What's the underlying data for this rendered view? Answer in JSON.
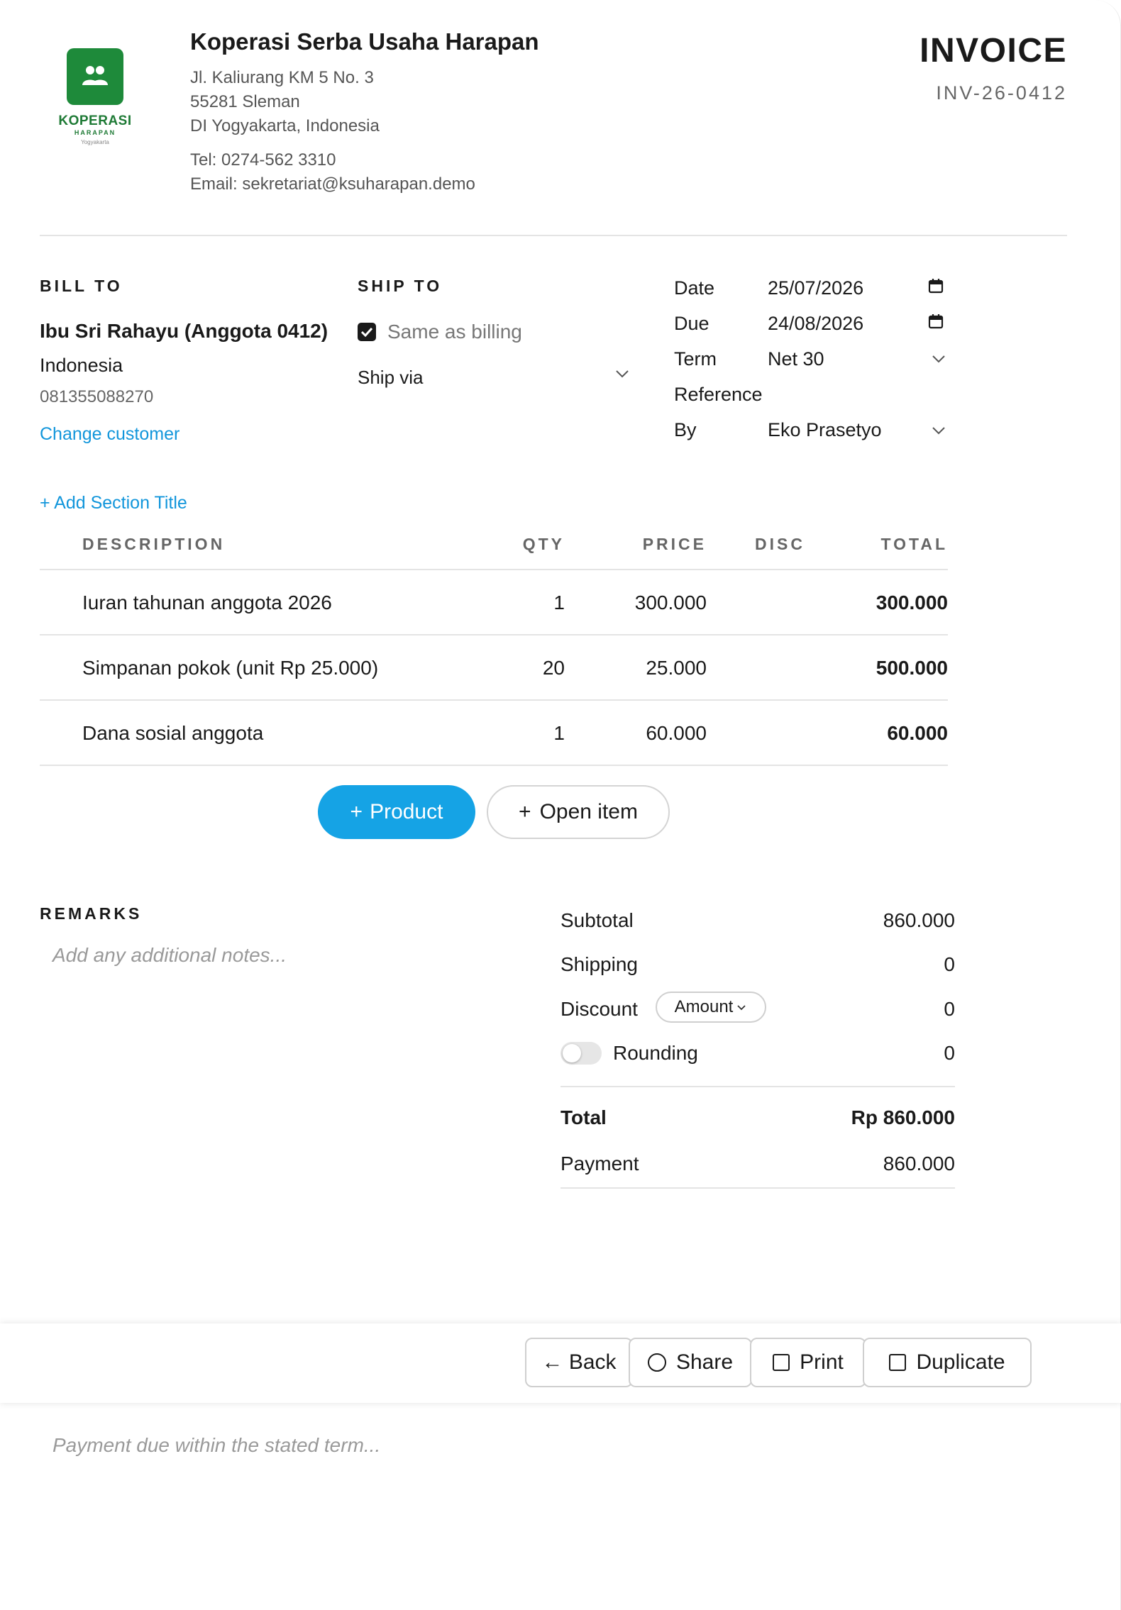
{
  "company": {
    "logo": {
      "name": "KOPERASI",
      "sub": "HARAPAN",
      "city": "Yogyakarta"
    },
    "name": "Koperasi Serba Usaha Harapan",
    "address_line1": "Jl. Kaliurang KM 5 No. 3",
    "address_line2": "55281 Sleman",
    "address_line3": "DI Yogyakarta, Indonesia",
    "tel": "Tel: 0274-562 3310",
    "email": "Email: sekretariat@ksuharapan.demo"
  },
  "document": {
    "title": "INVOICE",
    "number": "INV-26-0412"
  },
  "bill_to": {
    "label": "BILL TO",
    "name": "Ibu Sri Rahayu (Anggota 0412)",
    "country": "Indonesia",
    "phone": "081355088270",
    "change_link": "Change customer"
  },
  "ship_to": {
    "label": "SHIP TO",
    "same_as_billing": "Same as billing",
    "same_checked": true,
    "ship_via": "Ship via"
  },
  "meta": {
    "date_label": "Date",
    "date_value": "25/07/2026",
    "due_label": "Due",
    "due_value": "24/08/2026",
    "term_label": "Term",
    "term_value": "Net 30",
    "reference_label": "Reference",
    "reference_value": "",
    "by_label": "By",
    "by_value": "Eko Prasetyo"
  },
  "add_section": "+ Add Section Title",
  "table": {
    "headers": {
      "description": "DESCRIPTION",
      "qty": "QTY",
      "price": "PRICE",
      "disc": "DISC",
      "total": "TOTAL"
    },
    "rows": [
      {
        "description": "Iuran tahunan anggota 2026",
        "qty": "1",
        "price": "300.000",
        "disc": "",
        "total": "300.000"
      },
      {
        "description": "Simpanan pokok (unit Rp 25.000)",
        "qty": "20",
        "price": "25.000",
        "disc": "",
        "total": "500.000"
      },
      {
        "description": "Dana sosial anggota",
        "qty": "1",
        "price": "60.000",
        "disc": "",
        "total": "60.000"
      }
    ]
  },
  "buttons": {
    "product": "Product",
    "open_item": "Open item",
    "plus": "+"
  },
  "remarks": {
    "label": "REMARKS",
    "placeholder": "Add any additional notes..."
  },
  "summary": {
    "subtotal_label": "Subtotal",
    "subtotal_value": "860.000",
    "shipping_label": "Shipping",
    "shipping_value": "0",
    "discount_label": "Discount",
    "discount_mode": "Amount",
    "discount_value": "0",
    "rounding_label": "Rounding",
    "rounding_on": false,
    "rounding_value": "0",
    "total_label": "Total",
    "total_value": "Rp 860.000",
    "payment_label": "Payment",
    "payment_value": "860.000"
  },
  "actions": {
    "back": "← Back",
    "share": "Share",
    "print": "Print",
    "duplicate": "Duplicate"
  },
  "footer_note_placeholder": "Payment due within the stated term...",
  "colors": {
    "accent": "#15a3e5",
    "link": "#1296db",
    "brand_green": "#1e8a3a"
  }
}
